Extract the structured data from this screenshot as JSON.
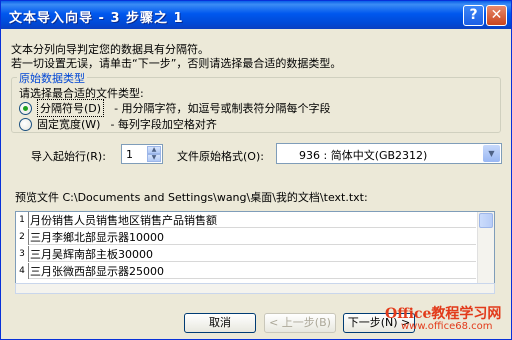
{
  "window": {
    "title": "文本导入向导 - 3 步骤之 1",
    "help_label": "?",
    "close_label": "✕"
  },
  "intro": {
    "line1": "文本分列向导判定您的数据具有分隔符。",
    "line2": "若一切设置无误，请单击“下一步”，否则请选择最合适的数据类型。"
  },
  "data_type": {
    "legend": "原始数据类型",
    "prompt": "请选择最合适的文件类型:",
    "options": [
      {
        "label": "分隔符号(D)",
        "desc": "- 用分隔字符，如逗号或制表符分隔每个字段",
        "selected": true
      },
      {
        "label": "固定宽度(W)",
        "desc": "- 每列字段加空格对齐",
        "selected": false
      }
    ]
  },
  "start_row": {
    "label": "导入起始行(R):",
    "value": "1"
  },
  "file_origin": {
    "label": "文件原始格式(O):",
    "value": "936 : 简体中文(GB2312)"
  },
  "preview": {
    "label": "预览文件 C:\\Documents and Settings\\wang\\桌面\\我的文档\\text.txt:",
    "rows": [
      {
        "num": "1",
        "text": "月份销售人员销售地区销售产品销售额"
      },
      {
        "num": "2",
        "text": "三月李鄉北部显示器10000"
      },
      {
        "num": "3",
        "text": "三月吴辉南部主板30000"
      },
      {
        "num": "4",
        "text": "三月张微西部显示器25000"
      }
    ]
  },
  "buttons": {
    "cancel": "取消",
    "back": "< 上一步(B)",
    "next": "下一步(N) >"
  },
  "watermark": {
    "line1": "Office教程学习网",
    "line2": "www.office68.com"
  },
  "colors": {
    "title_bar": "#0058ee",
    "legend": "#0046d5",
    "dialog_bg": "#ece9d8"
  }
}
